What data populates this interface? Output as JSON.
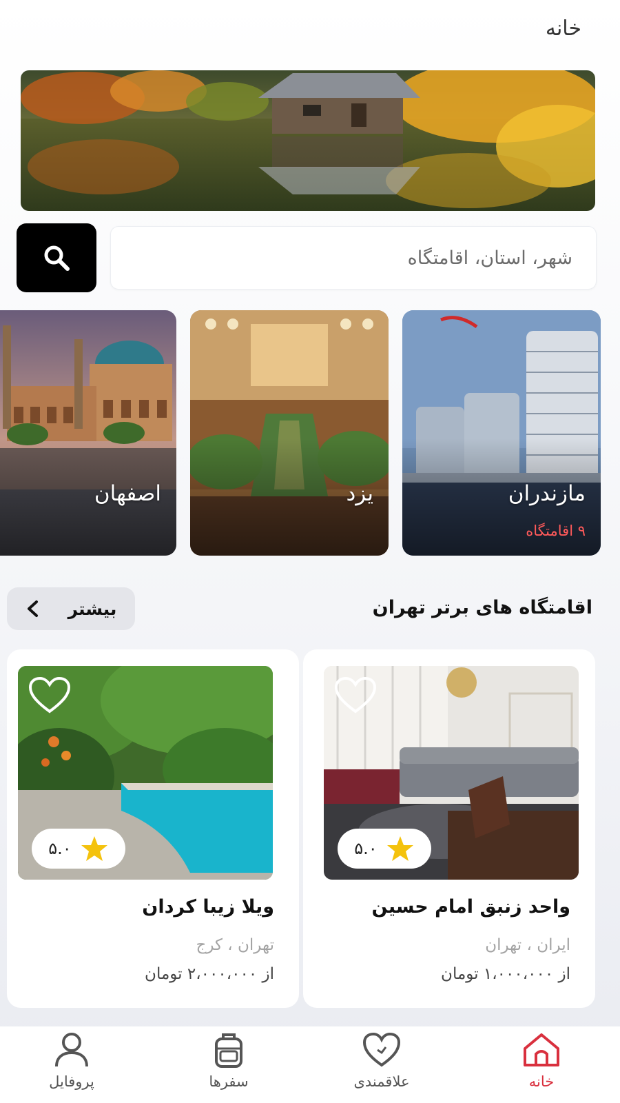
{
  "header": {
    "title": "خانه"
  },
  "search": {
    "placeholder": "شهر، استان، اقامتگاه"
  },
  "cities": [
    {
      "name": "مازندران",
      "count": "۹ اقامتگاه"
    },
    {
      "name": "یزد",
      "count": ""
    },
    {
      "name": "اصفهان",
      "count": ""
    }
  ],
  "top_section": {
    "title": "اقامتگاه های برتر تهران",
    "more_label": "بیشتر"
  },
  "listings": [
    {
      "title": "واحد زنبق امام حسین",
      "location": "ایران ، تهران",
      "price": "از ۱،۰۰۰،۰۰۰ تومان",
      "rating": "۵.۰"
    },
    {
      "title": "ویلا زیبا کردان",
      "location": "تهران ، کرج",
      "price": "از ۲،۰۰۰،۰۰۰ تومان",
      "rating": "۵.۰"
    }
  ],
  "nav": [
    {
      "label": "خانه",
      "icon": "home-icon",
      "active": true
    },
    {
      "label": "علاقمندی",
      "icon": "heart-icon",
      "active": false
    },
    {
      "label": "سفرها",
      "icon": "backpack-icon",
      "active": false
    },
    {
      "label": "پروفایل",
      "icon": "user-icon",
      "active": false
    }
  ],
  "colors": {
    "accent": "#d9303e",
    "count_red": "#ff5a5a",
    "star": "#f4c20d",
    "search_button": "#000000"
  }
}
